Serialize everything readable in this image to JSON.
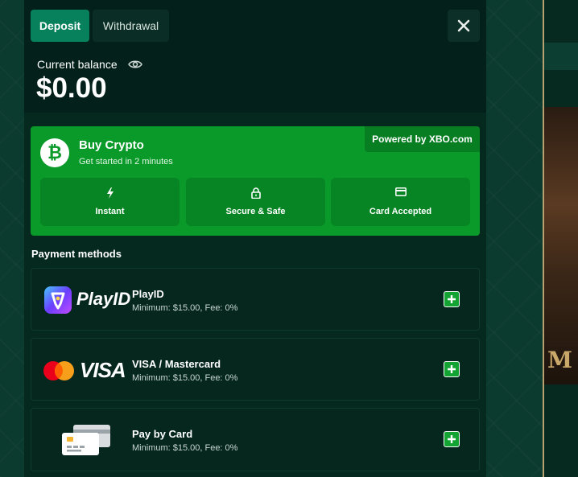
{
  "tabs": {
    "deposit": "Deposit",
    "withdrawal": "Withdrawal"
  },
  "balance": {
    "label": "Current balance",
    "amount": "$0.00"
  },
  "buy_crypto": {
    "title": "Buy Crypto",
    "subtitle": "Get started in 2 minutes",
    "powered_by": "Powered by XBO.com",
    "features": [
      {
        "label": "Instant",
        "icon": "bolt-icon"
      },
      {
        "label": "Secure & Safe",
        "icon": "lock-icon"
      },
      {
        "label": "Card Accepted",
        "icon": "card-icon"
      }
    ]
  },
  "payment_methods": {
    "title": "Payment methods",
    "items": [
      {
        "name": "PlayID",
        "logo_text": "PlayID",
        "info": "Minimum: $15.00, Fee: 0%"
      },
      {
        "name": "VISA / Mastercard",
        "logo_text": "VISA",
        "info": "Minimum: $15.00, Fee: 0%"
      },
      {
        "name": "Pay by Card",
        "info": "Minimum: $15.00, Fee: 0%"
      }
    ]
  },
  "background": {
    "glyph": "M"
  },
  "colors": {
    "accent": "#07805c",
    "crypto_green": "#0a9a2a",
    "panel": "#06291f"
  }
}
